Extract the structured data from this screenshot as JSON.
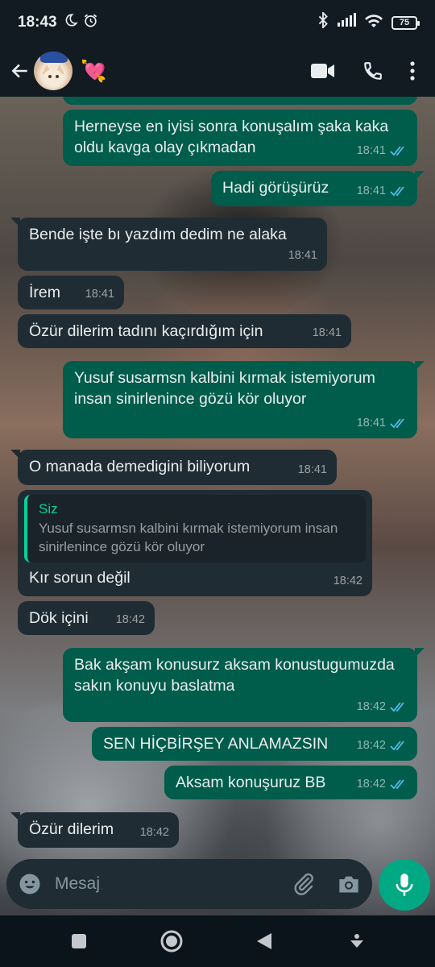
{
  "status_bar": {
    "time": "18:43",
    "battery": "75",
    "left_icons": [
      "moon-icon",
      "alarm-icon"
    ],
    "right_icons": [
      "bluetooth-icon",
      "signal-icon",
      "wifi-icon",
      "battery-icon"
    ]
  },
  "header": {
    "contact_emoji": "💘",
    "actions": [
      "video-call-icon",
      "voice-call-icon",
      "more-options-icon"
    ]
  },
  "messages": [
    {
      "dir": "out",
      "text": "Herneyse en iyisi sonra konuşalım şaka kaka oldu kavga olay çıkmadan",
      "time": "18:41",
      "read": true
    },
    {
      "dir": "out",
      "text": "Hadi görüşürüz",
      "time": "18:41",
      "read": true
    },
    {
      "dir": "in",
      "text": "Bende işte bı yazdım dedim ne alaka",
      "time": "18:41"
    },
    {
      "dir": "in",
      "text": "İrem",
      "time": "18:41"
    },
    {
      "dir": "in",
      "text": "Özür dilerim tadını kaçırdığım için",
      "time": "18:41"
    },
    {
      "dir": "out",
      "text": "Yusuf susarmsn kalbini kırmak istemiyorum insan sinirlenince gözü kör oluyor",
      "time": "18:41",
      "read": true
    },
    {
      "dir": "in",
      "text": "O manada demedigini biliyorum",
      "time": "18:41"
    },
    {
      "dir": "in",
      "text": "Kır sorun değil",
      "time": "18:42",
      "quote": {
        "name": "Siz",
        "text": "Yusuf susarmsn kalbini kırmak istemiyorum insan sinirlenince gözü kör oluyor"
      }
    },
    {
      "dir": "in",
      "text": "Dök içini",
      "time": "18:42"
    },
    {
      "dir": "out",
      "text": "Bak akşam konusurz aksam konustugumuzda sakın konuyu baslatma",
      "time": "18:42",
      "read": true
    },
    {
      "dir": "out",
      "text": "SEN HİÇBİRŞEY ANLAMAZSIN",
      "time": "18:42",
      "read": true
    },
    {
      "dir": "out",
      "text": "Aksam konuşuruz BB",
      "time": "18:42",
      "read": true
    },
    {
      "dir": "in",
      "text": "Özür dilerim",
      "time": "18:42"
    }
  ],
  "input": {
    "placeholder": "Mesaj",
    "icons": [
      "emoji-icon",
      "attach-icon",
      "camera-icon"
    ],
    "send_icon": "mic-icon"
  },
  "colors": {
    "outgoing_bubble": "#005c4b",
    "incoming_bubble": "#202c33",
    "accent": "#00a884",
    "read_ticks": "#53bdeb"
  }
}
